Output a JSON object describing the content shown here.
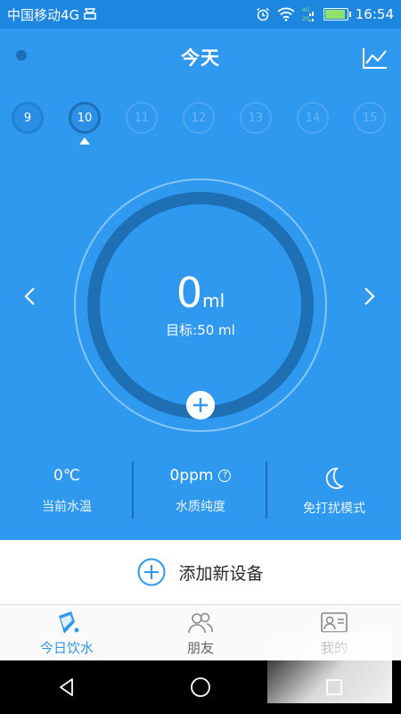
{
  "status_bar": {
    "carrier": "中国移动4G",
    "time": "16:54",
    "icons": [
      "sim-icon",
      "alarm-icon",
      "wifi-icon",
      "signal-4g-icon",
      "signal-2g-icon",
      "battery-icon"
    ]
  },
  "header": {
    "title": "今天",
    "trend_icon": "trend-chart-icon"
  },
  "dates": [
    {
      "label": "9",
      "state": "past"
    },
    {
      "label": "10",
      "state": "current"
    },
    {
      "label": "11",
      "state": "future"
    },
    {
      "label": "12",
      "state": "future"
    },
    {
      "label": "13",
      "state": "future"
    },
    {
      "label": "14",
      "state": "future"
    },
    {
      "label": "15",
      "state": "future"
    }
  ],
  "intake": {
    "amount": "0",
    "unit": "ml",
    "goal_text": "目标:50 ml",
    "progress": 0
  },
  "stats": [
    {
      "value": "0℃",
      "label": "当前水温"
    },
    {
      "value": "0ppm",
      "label": "水质纯度"
    },
    {
      "value": "",
      "label": "免打扰模式"
    }
  ],
  "add_device": {
    "label": "添加新设备"
  },
  "tabs": [
    {
      "label": "今日饮水",
      "active": true
    },
    {
      "label": "朋友",
      "active": false
    },
    {
      "label": "我的",
      "active": false
    }
  ],
  "colors": {
    "primary": "#2f98ef",
    "dark_ring": "#1f6fb4",
    "status_bar": "#1d86df"
  }
}
